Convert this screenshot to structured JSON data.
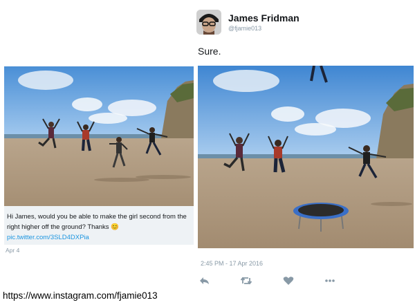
{
  "left_tweet": {
    "message": "Hi James, would you be able to make the girl second from the right higher off the ground? Thanks",
    "emoji": "😊",
    "link": "pic.twitter.com/3SLD4DXPia",
    "date": "Apr 4"
  },
  "right_tweet": {
    "author_name": "James Fridman",
    "author_handle": "@fjamie013",
    "text": "Sure.",
    "timestamp": "2:45 PM - 17 Apr 2016",
    "actions": [
      {
        "icon": "reply-icon"
      },
      {
        "icon": "retweet-icon"
      },
      {
        "icon": "heart-icon"
      },
      {
        "icon": "more-icon"
      }
    ]
  },
  "footer": {
    "url": "https://www.instagram.com/fjamie013"
  },
  "colors": {
    "link": "#1b95e0",
    "muted": "#8899a6",
    "caption_bg": "#eef2f5",
    "trampoline": "#3a6fc7"
  }
}
